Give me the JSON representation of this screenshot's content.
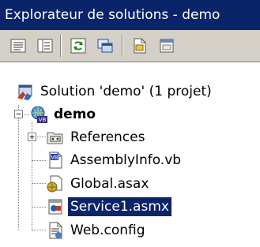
{
  "window": {
    "title": "Explorateur de solutions - demo"
  },
  "toolbar": {
    "buttons": [
      {
        "icon": "properties-icon"
      },
      {
        "icon": "show-all-files-icon"
      },
      {
        "icon": "refresh-icon"
      },
      {
        "icon": "copy-project-icon"
      },
      {
        "icon": "view-code-icon"
      },
      {
        "icon": "view-designer-icon"
      }
    ]
  },
  "tree": {
    "solution": "Solution 'demo' (1 projet)",
    "project": "demo",
    "items": [
      {
        "label": "References",
        "icon": "references-folder-icon"
      },
      {
        "label": "AssemblyInfo.vb",
        "icon": "vb-file-icon"
      },
      {
        "label": "Global.asax",
        "icon": "global-asax-icon"
      },
      {
        "label": "Service1.asmx",
        "icon": "web-service-icon",
        "selected": true
      },
      {
        "label": "Web.config",
        "icon": "web-config-icon"
      }
    ],
    "expander_plus": "+",
    "expander_minus": "−"
  }
}
